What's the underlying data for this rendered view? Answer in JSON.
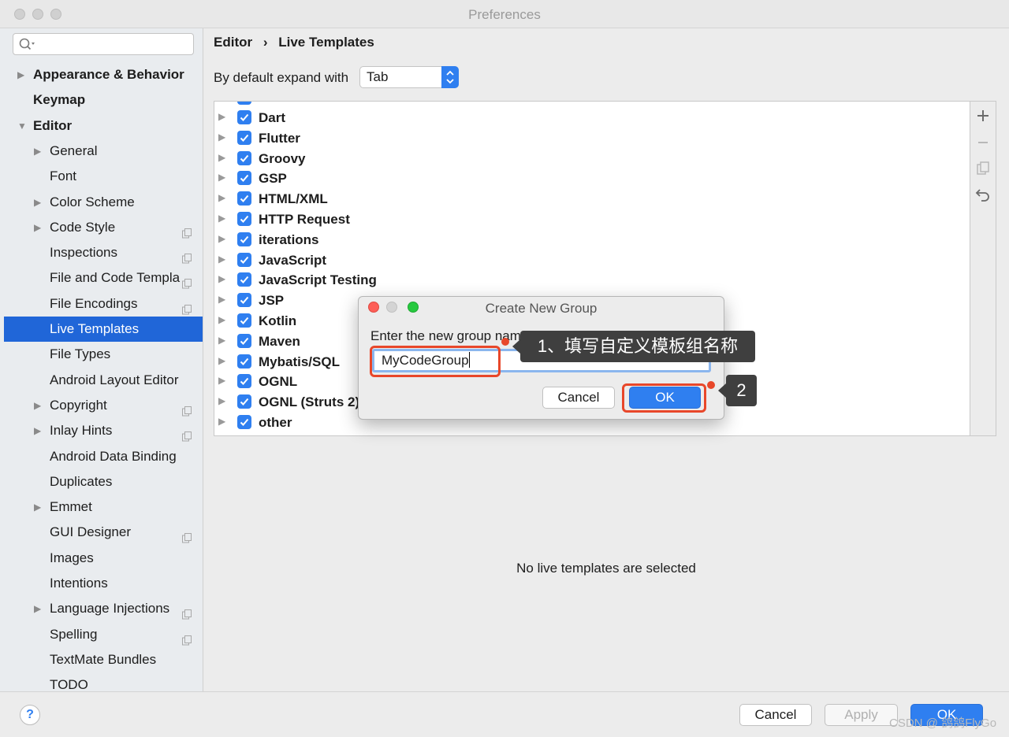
{
  "window": {
    "title": "Preferences"
  },
  "sidebar": {
    "search_placeholder": "",
    "items": [
      {
        "label": "Appearance & Behavior",
        "level": 0,
        "expandable": true,
        "expanded": false,
        "bold": true
      },
      {
        "label": "Keymap",
        "level": 0,
        "expandable": false,
        "bold": true
      },
      {
        "label": "Editor",
        "level": 0,
        "expandable": true,
        "expanded": true,
        "bold": true
      },
      {
        "label": "General",
        "level": 1,
        "expandable": true
      },
      {
        "label": "Font",
        "level": 1,
        "expandable": false
      },
      {
        "label": "Color Scheme",
        "level": 1,
        "expandable": true
      },
      {
        "label": "Code Style",
        "level": 1,
        "expandable": true,
        "copy_icon": true
      },
      {
        "label": "Inspections",
        "level": 1,
        "expandable": false,
        "copy_icon": true
      },
      {
        "label": "File and Code Templa",
        "level": 1,
        "expandable": false,
        "copy_icon": true
      },
      {
        "label": "File Encodings",
        "level": 1,
        "expandable": false,
        "copy_icon": true
      },
      {
        "label": "Live Templates",
        "level": 1,
        "expandable": false,
        "selected": true
      },
      {
        "label": "File Types",
        "level": 1,
        "expandable": false
      },
      {
        "label": "Android Layout Editor",
        "level": 1,
        "expandable": false
      },
      {
        "label": "Copyright",
        "level": 1,
        "expandable": true,
        "copy_icon": true
      },
      {
        "label": "Inlay Hints",
        "level": 1,
        "expandable": true,
        "copy_icon": true
      },
      {
        "label": "Android Data Binding",
        "level": 1,
        "expandable": false
      },
      {
        "label": "Duplicates",
        "level": 1,
        "expandable": false
      },
      {
        "label": "Emmet",
        "level": 1,
        "expandable": true
      },
      {
        "label": "GUI Designer",
        "level": 1,
        "expandable": false,
        "copy_icon": true
      },
      {
        "label": "Images",
        "level": 1,
        "expandable": false
      },
      {
        "label": "Intentions",
        "level": 1,
        "expandable": false
      },
      {
        "label": "Language Injections",
        "level": 1,
        "expandable": true,
        "copy_icon": true
      },
      {
        "label": "Spelling",
        "level": 1,
        "expandable": false,
        "copy_icon": true
      },
      {
        "label": "TextMate Bundles",
        "level": 1,
        "expandable": false
      },
      {
        "label": "TODO",
        "level": 1,
        "expandable": false
      }
    ]
  },
  "main": {
    "breadcrumb": {
      "parent": "Editor",
      "separator": "›",
      "current": "Live Templates"
    },
    "expand_label": "By default expand with",
    "expand_value": "Tab",
    "template_groups": [
      {
        "name": "Dart",
        "checked": true
      },
      {
        "name": "Flutter",
        "checked": true
      },
      {
        "name": "Groovy",
        "checked": true
      },
      {
        "name": "GSP",
        "checked": true
      },
      {
        "name": "HTML/XML",
        "checked": true
      },
      {
        "name": "HTTP Request",
        "checked": true
      },
      {
        "name": "iterations",
        "checked": true
      },
      {
        "name": "JavaScript",
        "checked": true
      },
      {
        "name": "JavaScript Testing",
        "checked": true
      },
      {
        "name": "JSP",
        "checked": true
      },
      {
        "name": "Kotlin",
        "checked": true
      },
      {
        "name": "Maven",
        "checked": true
      },
      {
        "name": "Mybatis/SQL",
        "checked": true
      },
      {
        "name": "OGNL",
        "checked": true
      },
      {
        "name": "OGNL (Struts 2)",
        "checked": true
      },
      {
        "name": "other",
        "checked": true
      }
    ],
    "toolbar_icons": [
      "add-icon",
      "remove-icon",
      "copy-icon",
      "undo-icon"
    ],
    "empty_message": "No live templates are selected"
  },
  "dialog": {
    "title": "Create New Group",
    "prompt": "Enter the new group name:",
    "input_value": "MyCodeGroup",
    "cancel_label": "Cancel",
    "ok_label": "OK"
  },
  "annotations": {
    "callout_1": "1、填写自定义模板组名称",
    "callout_2": "2",
    "highlight_color": "#e8472a"
  },
  "footer": {
    "help_label": "?",
    "cancel_label": "Cancel",
    "apply_label": "Apply",
    "ok_label": "OK",
    "watermark": "CSDN @ 鸽鸽FlyGo"
  },
  "colors": {
    "accent": "#2f7ff0",
    "selection": "#2066d8"
  }
}
